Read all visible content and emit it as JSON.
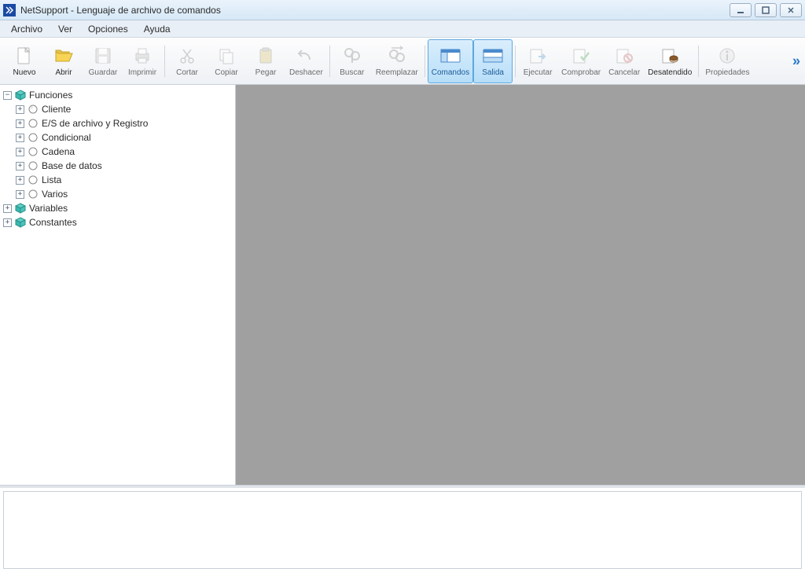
{
  "title": "NetSupport - Lenguaje de archivo de comandos",
  "menu": {
    "archivo": "Archivo",
    "ver": "Ver",
    "opciones": "Opciones",
    "ayuda": "Ayuda"
  },
  "toolbar": {
    "nuevo": "Nuevo",
    "abrir": "Abrir",
    "guardar": "Guardar",
    "imprimir": "Imprimir",
    "cortar": "Cortar",
    "copiar": "Copiar",
    "pegar": "Pegar",
    "deshacer": "Deshacer",
    "buscar": "Buscar",
    "reemplazar": "Reemplazar",
    "comandos": "Comandos",
    "salida": "Salida",
    "ejecutar": "Ejecutar",
    "comprobar": "Comprobar",
    "cancelar": "Cancelar",
    "desatendido": "Desatendido",
    "propiedades": "Propiedades"
  },
  "tree": {
    "funciones": "Funciones",
    "cliente": "Cliente",
    "es_archivo": "E/S de archivo y Registro",
    "condicional": "Condicional",
    "cadena": "Cadena",
    "basedatos": "Base de datos",
    "lista": "Lista",
    "varios": "Varios",
    "variables": "Variables",
    "constantes": "Constantes"
  }
}
